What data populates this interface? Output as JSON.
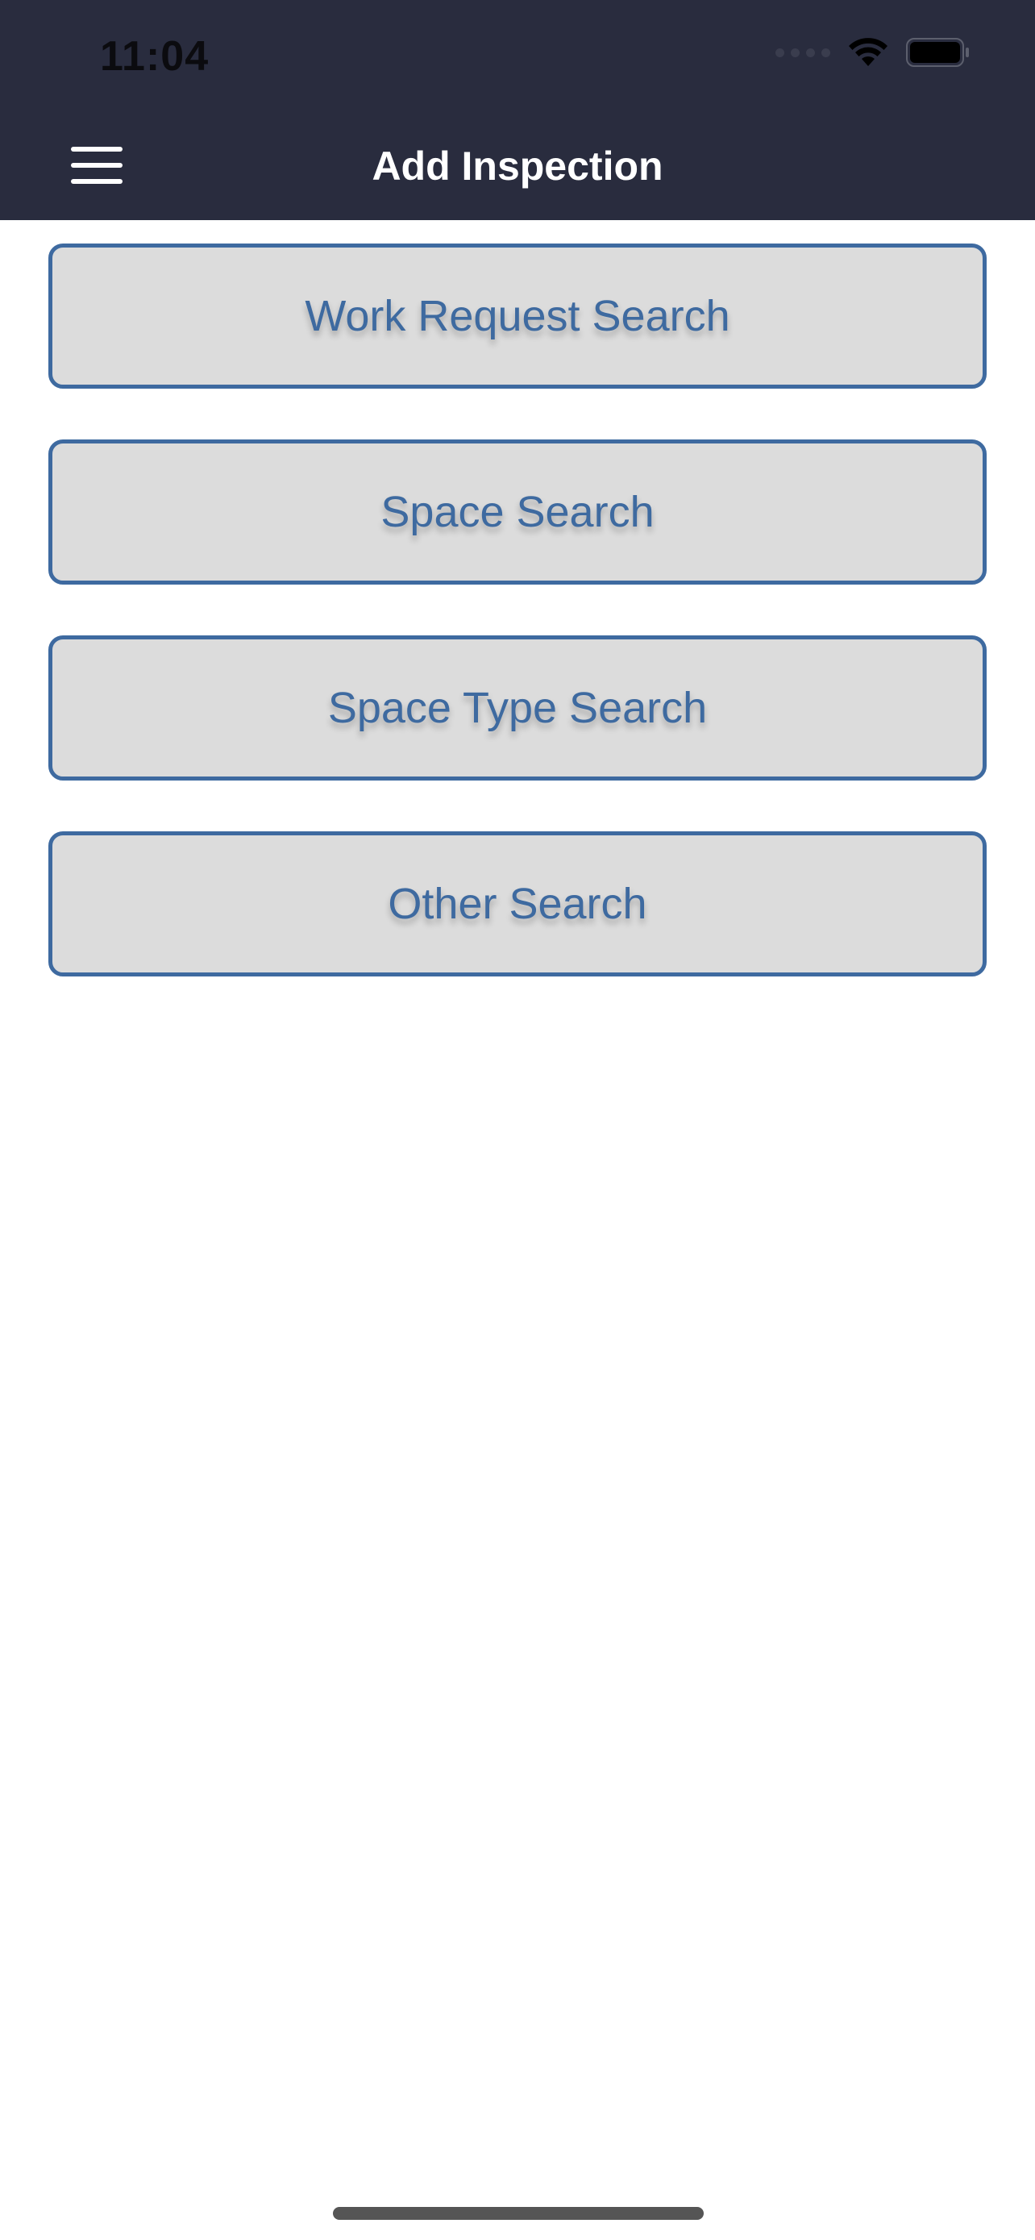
{
  "status_bar": {
    "time": "11:04"
  },
  "header": {
    "title": "Add Inspection",
    "menu_icon": "hamburger-menu-icon",
    "background_color": "#292c3e"
  },
  "search_buttons": [
    {
      "label": "Work Request Search"
    },
    {
      "label": "Space Search"
    },
    {
      "label": "Space Type Search"
    },
    {
      "label": "Other Search"
    }
  ],
  "colors": {
    "accent": "#3e6aa0",
    "button_fill": "#dcdcdc"
  }
}
